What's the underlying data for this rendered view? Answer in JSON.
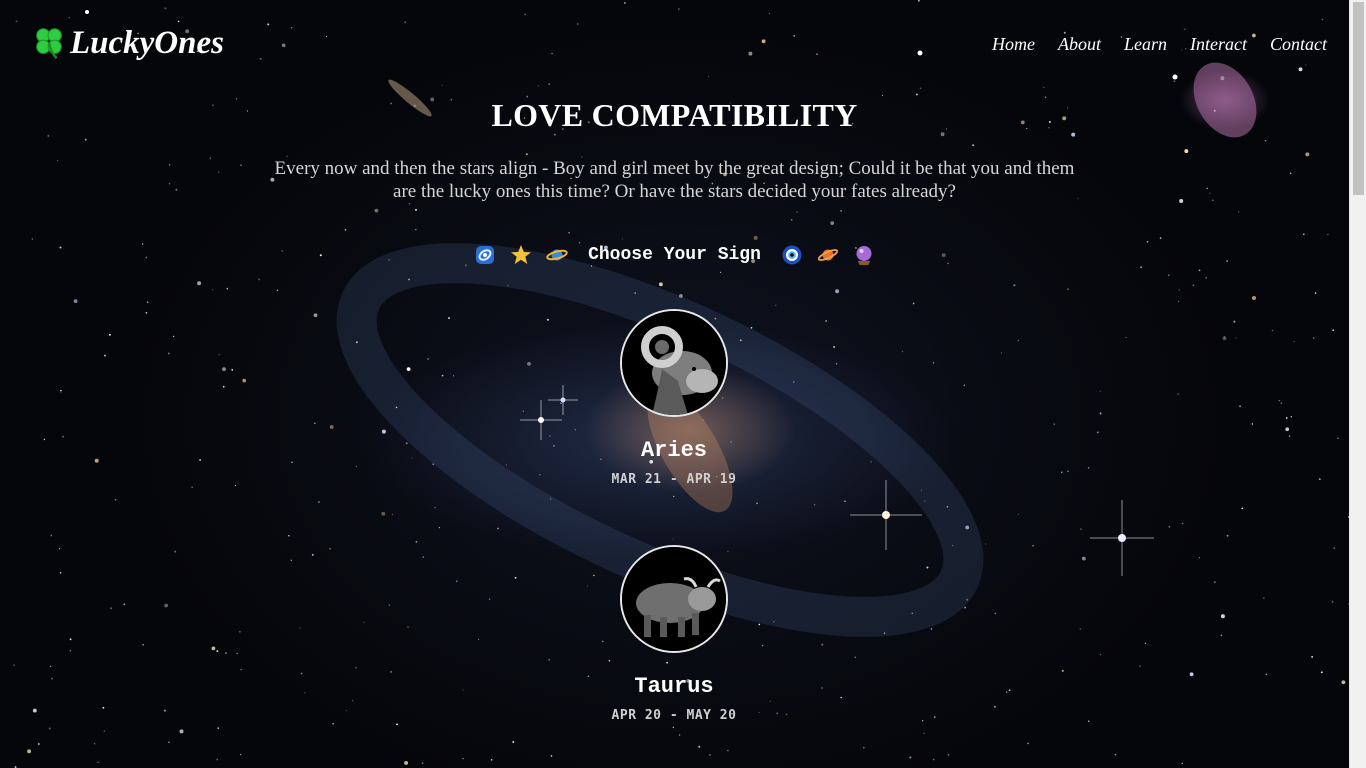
{
  "header": {
    "logo_text": "LuckyOnes",
    "logo_icon": "four-leaf-clover",
    "nav": [
      "Home",
      "About",
      "Learn",
      "Interact",
      "Contact"
    ]
  },
  "main": {
    "title": "LOVE COMPATIBILITY",
    "intro": "Every now and then the stars align - Boy and girl meet by the great design; Could it be that you and them are the lucky ones this time? Or have the stars decided your fates already?",
    "choose_label": "Choose Your Sign",
    "choose_icons": [
      "milky-way-icon",
      "star-icon",
      "ringed-planet-icon",
      "nazar-amulet-icon",
      "saturn-icon",
      "crystal-ball-icon"
    ],
    "signs": [
      {
        "name": "Aries",
        "dates": "MAR 21 - APR 19",
        "icon": "ram-icon"
      },
      {
        "name": "Taurus",
        "dates": "APR 20 - MAY 20",
        "icon": "bull-icon"
      }
    ]
  },
  "colors": {
    "background": "#06070c",
    "text": "#ffffff",
    "intro_text": "#d6d6d6",
    "clover": "#2ecc40"
  }
}
